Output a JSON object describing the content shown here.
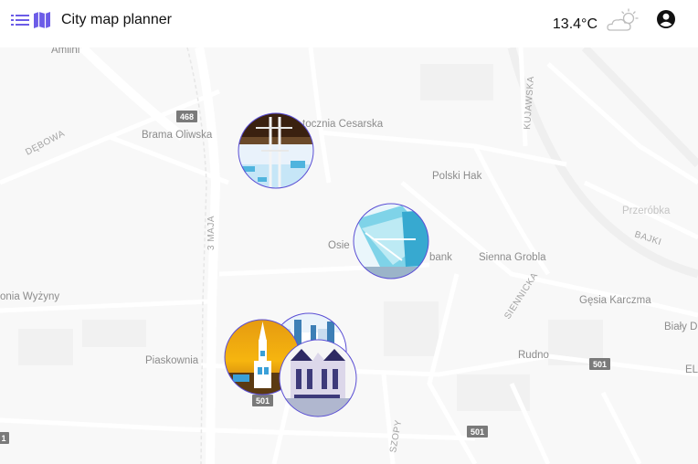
{
  "header": {
    "app_title": "City map planner",
    "temperature": "13.4°C",
    "weather_icon": "partly-cloudy-icon",
    "list_icon": "list-icon",
    "map_icon": "map-icon",
    "account_icon": "account-circle-icon",
    "accent_color": "#6c5ce7"
  },
  "map": {
    "place_labels": {
      "brama_oliwska": "Brama Oliwska",
      "stocznia": "tocznia Cesarska",
      "polski_hak": "Polski Hak",
      "osie": "Osie",
      "bank": "bank",
      "sienna_grobla": "Sienna Grobla",
      "przerobka": "Przeróbka",
      "gesia_karczma": "Gęsia Karczma",
      "bialy_d": "Biały D",
      "rudno": "Rudno",
      "el": "EL",
      "onia_wyzyny": "onia Wyżyny",
      "piaskownia": "Piaskownia",
      "amlini": "Amlini"
    },
    "street_labels": {
      "debowa": "DĘBOWA",
      "trzeciego_maja": "3 MAJA",
      "kujawska": "KUJAWSKA",
      "siennicka": "SIENNICKA",
      "bajki": "BAJKI",
      "szopy": "SZOPY"
    },
    "road_shields": {
      "s468": "468",
      "s501a": "501",
      "s501b": "501",
      "s501c": "501",
      "s1": "1"
    },
    "markers": [
      {
        "name": "shipyard-cranes-marker"
      },
      {
        "name": "museum-building-marker"
      },
      {
        "name": "town-hall-tower-marker"
      },
      {
        "name": "old-town-marker"
      },
      {
        "name": "gothic-facade-marker"
      }
    ]
  }
}
